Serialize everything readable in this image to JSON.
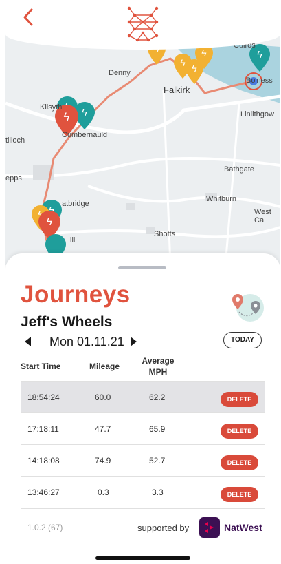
{
  "header": {
    "back_icon": "chevron-left-icon",
    "logo_icon": "network-logo-icon",
    "accent": "#e0533e"
  },
  "map": {
    "labels": {
      "culross": "Culros",
      "denny": "Denny",
      "falkirk": "Falkirk",
      "boness": "Bo'ness",
      "kilsyth": "Kilsyth",
      "cumbernauld": "Cumbernauld",
      "linlithgow": "Linlithgow",
      "kirkintilloch": "tilloch",
      "bathgate": "Bathgate",
      "bishopbriggs": "epps",
      "coatbridge": "atbridge",
      "whitburn": "Whitburn",
      "westcalder": "West Ca",
      "shotts": "Shotts",
      "bellshill": "ill"
    },
    "pin_colors": {
      "red": "#e0533e",
      "teal": "#1f9e9b",
      "yellow": "#f2b132"
    },
    "route_color": "#e88a73"
  },
  "sheet": {
    "title": "Journeys",
    "subtitle": "Jeff's Wheels",
    "date": "Mon 01.11.21",
    "today_label": "TODAY",
    "journey_icon": "map-pins-icon"
  },
  "table": {
    "headers": {
      "start": "Start Time",
      "mileage": "Mileage",
      "mph_line1": "Average",
      "mph_line2": "MPH"
    },
    "rows": [
      {
        "start": "18:54:24",
        "mileage": "60.0",
        "mph": "62.2",
        "delete": "DELETE"
      },
      {
        "start": "17:18:11",
        "mileage": "47.7",
        "mph": "65.9",
        "delete": "DELETE"
      },
      {
        "start": "14:18:08",
        "mileage": "74.9",
        "mph": "52.7",
        "delete": "DELETE"
      },
      {
        "start": "13:46:27",
        "mileage": "0.3",
        "mph": "3.3",
        "delete": "DELETE"
      }
    ]
  },
  "footer": {
    "version": "1.0.2 (67)",
    "supported_by": "supported by",
    "brand": "NatWest",
    "brand_color": "#3c1053"
  }
}
